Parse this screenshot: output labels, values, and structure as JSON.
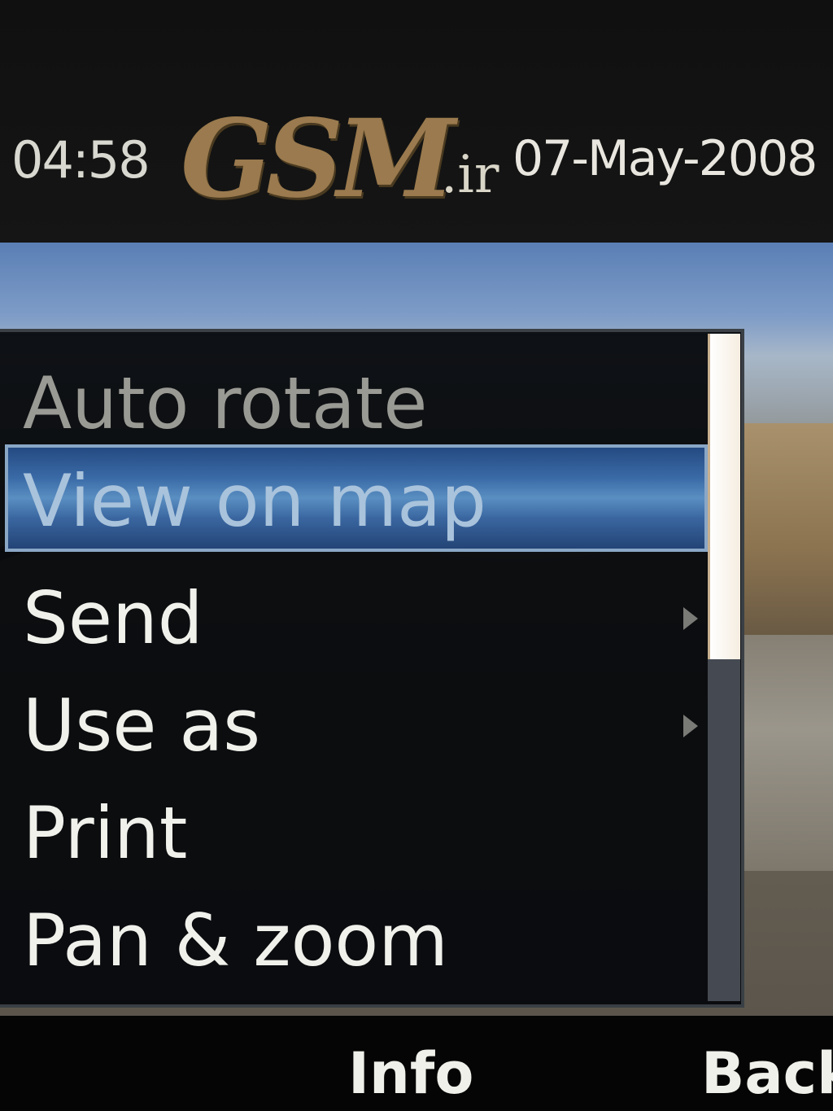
{
  "status_bar": {
    "time": "04:58",
    "logo_text": "GSM",
    "logo_suffix": ".ir",
    "date": "07-May-2008"
  },
  "menu": {
    "items": [
      {
        "label": "Auto rotate",
        "state": "dimmed",
        "has_submenu": false
      },
      {
        "label": "View on map",
        "state": "selected",
        "has_submenu": false
      },
      {
        "label": "Send",
        "state": "normal",
        "has_submenu": true
      },
      {
        "label": "Use as",
        "state": "normal",
        "has_submenu": true
      },
      {
        "label": "Print",
        "state": "normal",
        "has_submenu": false
      },
      {
        "label": "Pan & zoom",
        "state": "normal",
        "has_submenu": false
      }
    ],
    "scroll_position": 0.0
  },
  "softkeys": {
    "center": "Info",
    "right": "Back"
  },
  "colors": {
    "selection": "#3a6aa6",
    "menu_background": "#06080c",
    "text": "#f1f1ec"
  }
}
